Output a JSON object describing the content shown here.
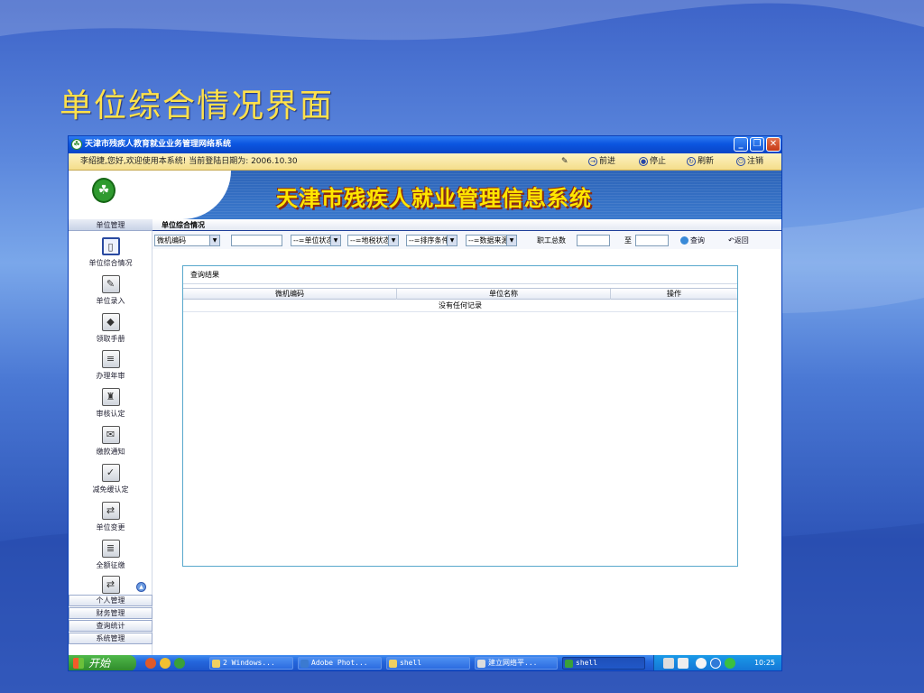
{
  "slide_title": "单位综合情况界面",
  "window": {
    "title": "天津市残疾人教育就业业务管理网络系统",
    "buttons": {
      "minimize": "_",
      "maximize": "❐",
      "close": "✕"
    }
  },
  "infobar": {
    "greeting": "李绍捷,您好,欢迎使用本系统! 当前登陆日期为: 2006.10.30",
    "nav": [
      {
        "label": "前进",
        "icon": "forward-icon",
        "glyph": "→"
      },
      {
        "label": "停止",
        "icon": "stop-icon",
        "glyph": "●"
      },
      {
        "label": "刷新",
        "icon": "refresh-icon",
        "glyph": "↻"
      },
      {
        "label": "注销",
        "icon": "logout-icon",
        "glyph": "⏻"
      }
    ]
  },
  "banner": {
    "title": "天津市残疾人就业管理信息系统",
    "logo_glyph": "☘"
  },
  "sidebar": {
    "section": "单位管理",
    "items": [
      {
        "label": "单位综合情况",
        "icon": "building-icon",
        "glyph": "▯",
        "active": true
      },
      {
        "label": "单位录入",
        "icon": "folder-open-icon",
        "glyph": "✎"
      },
      {
        "label": "领取手册",
        "icon": "book-icon",
        "glyph": "◆"
      },
      {
        "label": "办理年审",
        "icon": "document-icon",
        "glyph": "≡"
      },
      {
        "label": "审核认定",
        "icon": "audit-icon",
        "glyph": "♜"
      },
      {
        "label": "缴款通知",
        "icon": "notice-icon",
        "glyph": "✉"
      },
      {
        "label": "减免缓认定",
        "icon": "reduction-icon",
        "glyph": "✓"
      },
      {
        "label": "单位变更",
        "icon": "change-icon",
        "glyph": "⇄"
      },
      {
        "label": "全额征缴",
        "icon": "levy-icon",
        "glyph": "≣"
      }
    ],
    "more_glyph": "⇄",
    "groups": [
      "个人管理",
      "财务管理",
      "查询统计",
      "系统管理"
    ]
  },
  "main": {
    "breadcrumb": "单位综合情况",
    "toolbar": {
      "select_code": "微机编码",
      "select_status": "--=单位状态",
      "select_tax": "--=地税状态",
      "select_sort": "--=排序条件",
      "select_source": "--=数据来源",
      "employee_label": "职工总数",
      "to_label": "至",
      "query_label": "查询",
      "back_label": "返回"
    },
    "results": {
      "title": "查询结果",
      "columns": [
        "微机编码",
        "单位名称",
        "操作"
      ],
      "empty": "没有任何记录"
    }
  },
  "taskbar": {
    "start_label": "开始",
    "tasks": [
      {
        "label": "2 Windows...",
        "active": false
      },
      {
        "label": "Adobe Phot...",
        "active": false
      },
      {
        "label": "shell",
        "active": false
      },
      {
        "label": "建立网络平...",
        "active": false
      },
      {
        "label": "shell",
        "active": true
      }
    ],
    "clock": "10:25"
  },
  "colors": {
    "slide_title": "#ffe14a",
    "banner_title": "#ffe600",
    "titlebar": "#0b55e0",
    "results_border": "#58a8cc"
  }
}
